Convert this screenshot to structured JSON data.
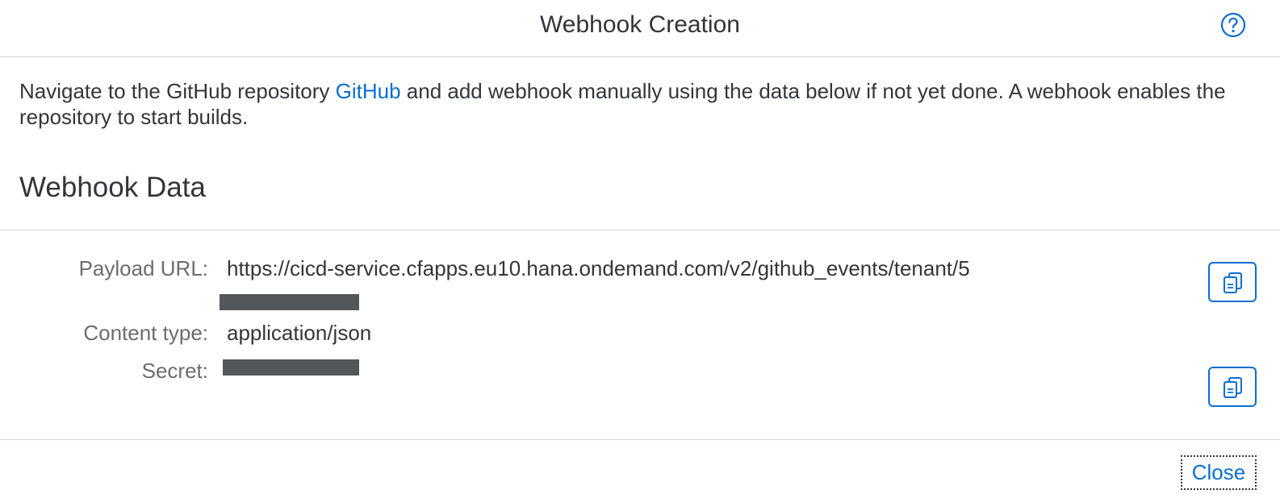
{
  "dialog": {
    "title": "Webhook Creation",
    "help_icon": "help-circle-icon"
  },
  "intro": {
    "text_before": "Navigate to the GitHub repository ",
    "link_text": "GitHub",
    "text_after": " and add webhook manually using the data below if not yet done. A webhook enables the repository to start builds."
  },
  "section": {
    "title": "Webhook Data"
  },
  "fields": {
    "payload_url": {
      "label": "Payload URL:",
      "value": "https://cicd-service.cfapps.eu10.hana.ondemand.com/v2/github_events/tenant/5"
    },
    "content_type": {
      "label": "Content type:",
      "value": "application/json"
    },
    "secret": {
      "label": "Secret:"
    }
  },
  "footer": {
    "close_label": "Close"
  },
  "colors": {
    "accent": "#0a6ed1",
    "text": "#32363a",
    "label": "#6a6d70",
    "redaction": "#54575a"
  },
  "icons": {
    "copy": "copy-icon",
    "help": "help-circle-icon"
  }
}
